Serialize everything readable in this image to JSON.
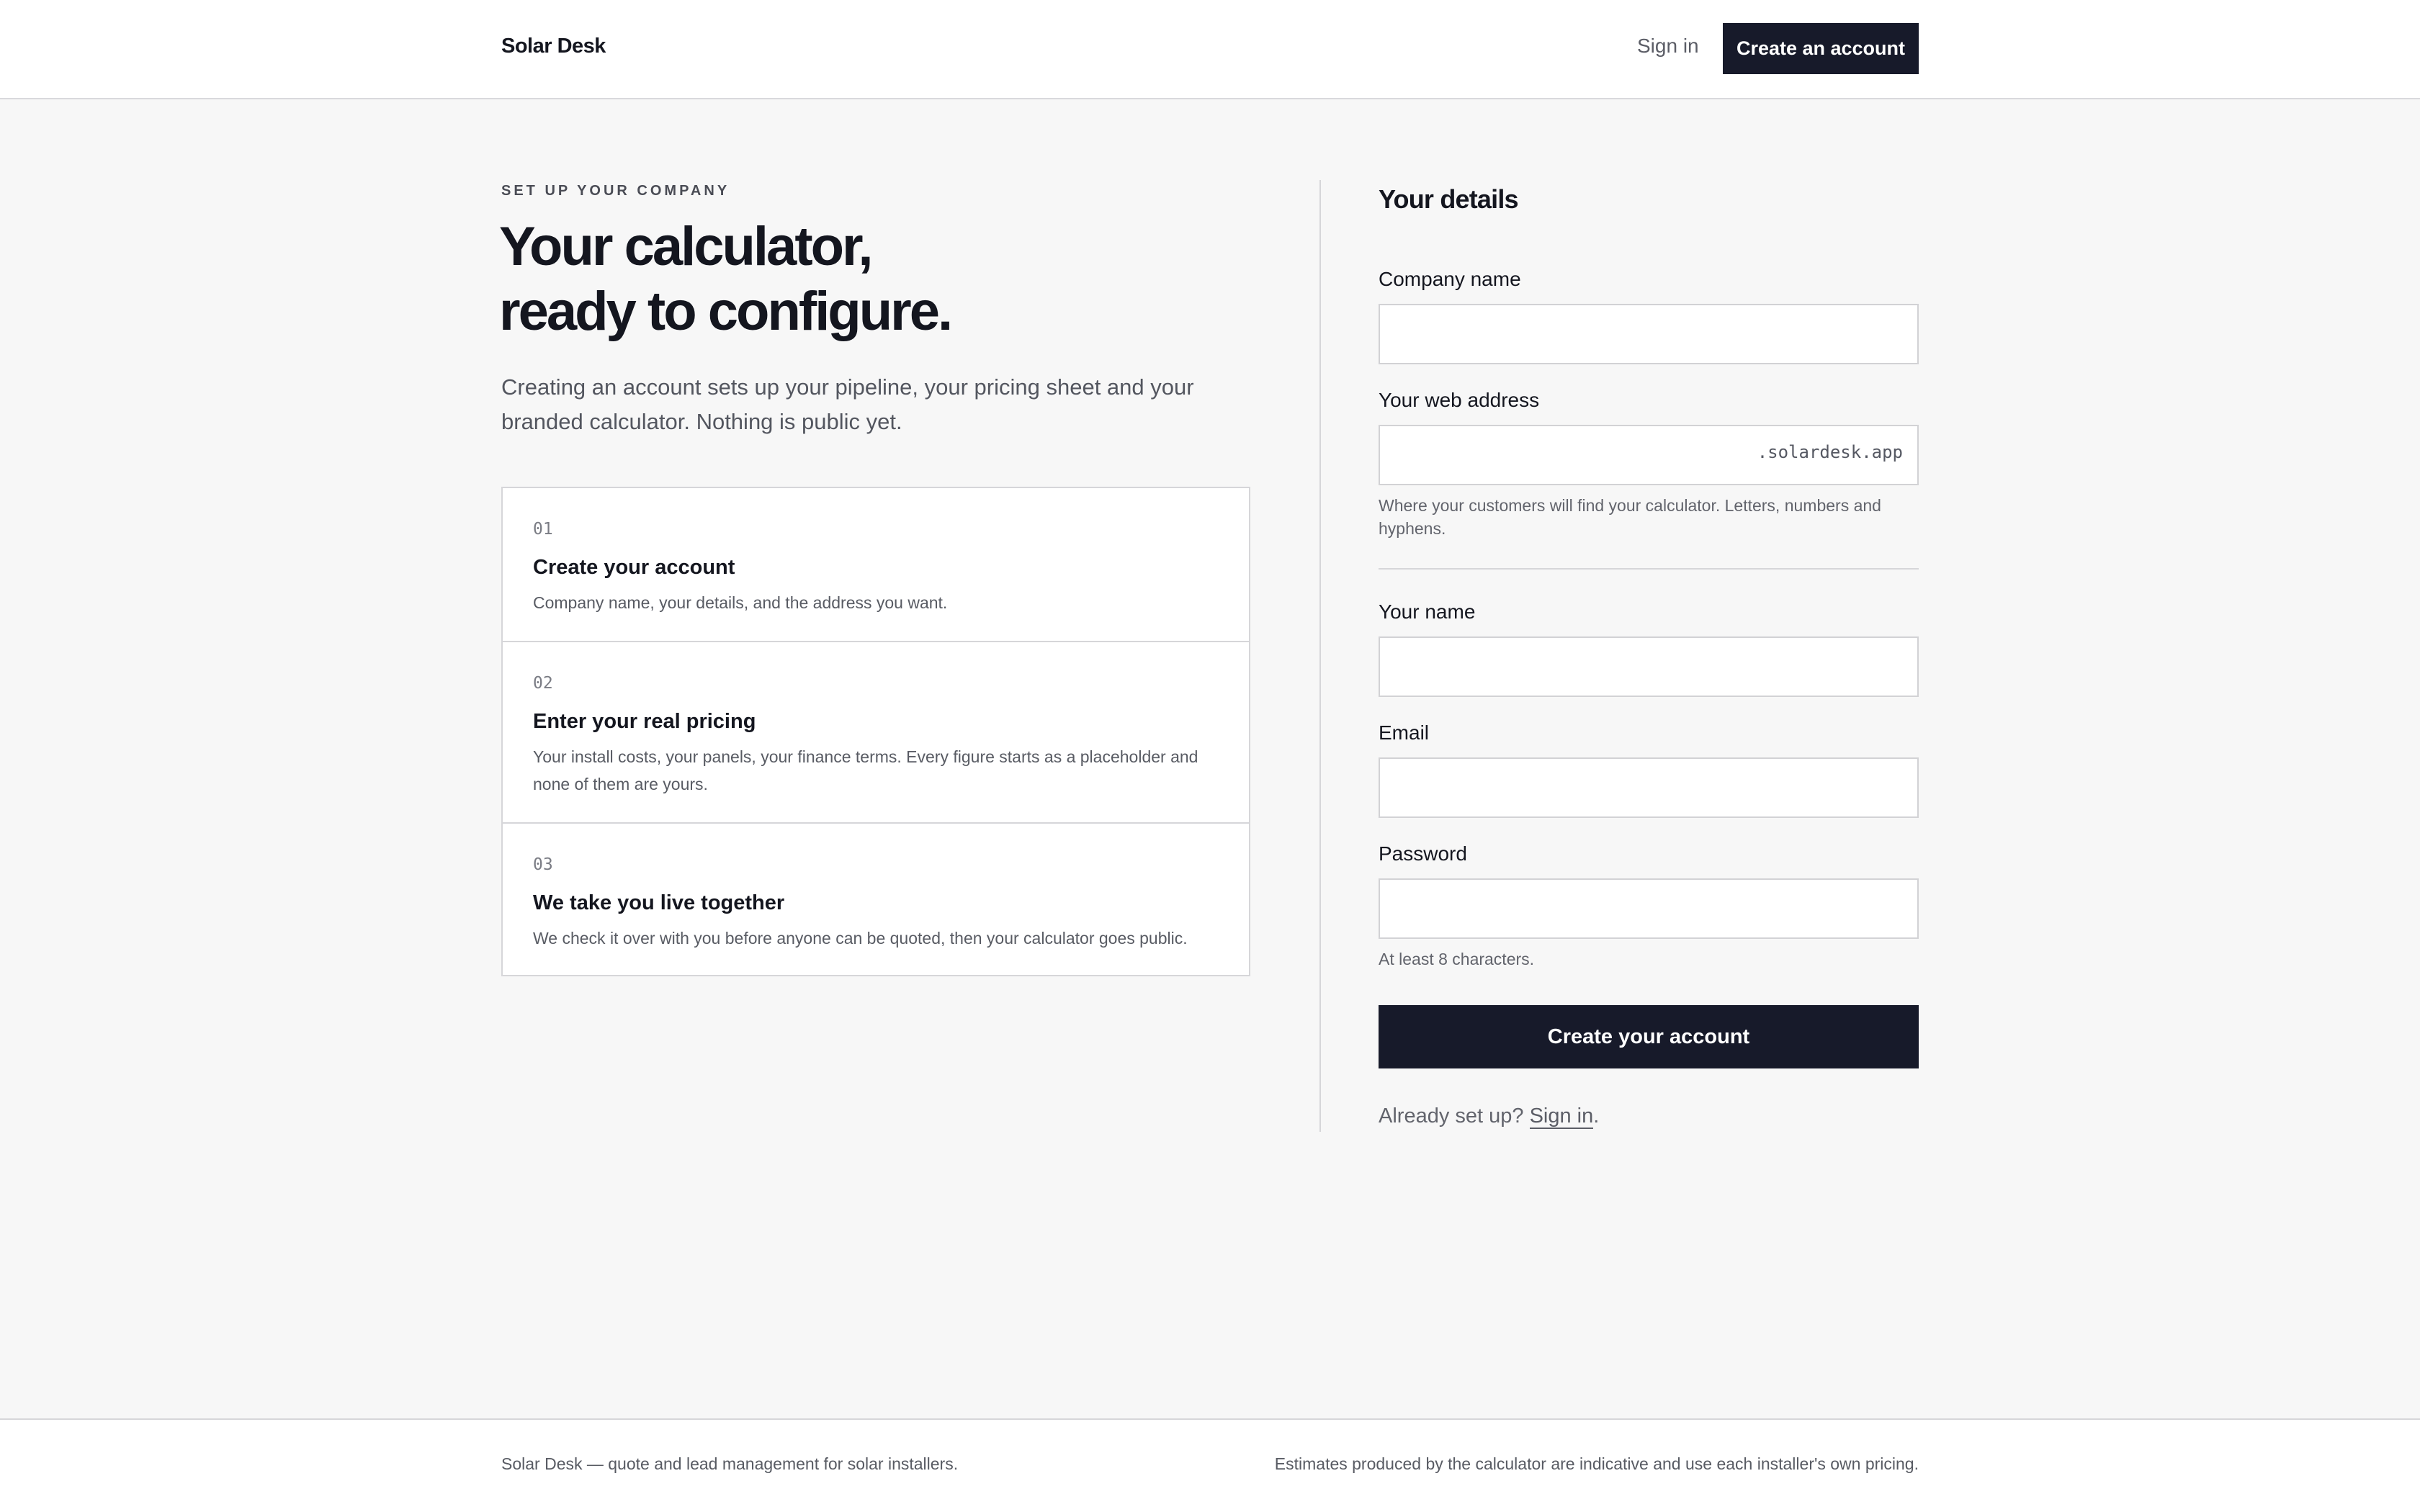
{
  "header": {
    "brand": "Solar Desk",
    "sign_in": "Sign in",
    "create_account": "Create an account"
  },
  "intro": {
    "eyebrow": "SET UP YOUR COMPANY",
    "title_line1": "Your calculator,",
    "title_line2": "ready to configure.",
    "description": "Creating an account sets up your pipeline, your pricing sheet and your branded calculator. Nothing is public yet."
  },
  "steps": [
    {
      "number": "01",
      "title": "Create your account",
      "description": "Company name, your details, and the address you want."
    },
    {
      "number": "02",
      "title": "Enter your real pricing",
      "description": "Your install costs, your panels, your finance terms. Every figure starts as a placeholder and none of them are yours."
    },
    {
      "number": "03",
      "title": "We take you live together",
      "description": "We check it over with you before anyone can be quoted, then your calculator goes public."
    }
  ],
  "form": {
    "title": "Your details",
    "company_name": {
      "label": "Company name",
      "value": ""
    },
    "web_address": {
      "label": "Your web address",
      "value": "",
      "suffix": ".solardesk.app",
      "hint": "Where your customers will find your calculator. Letters, numbers and hyphens."
    },
    "your_name": {
      "label": "Your name",
      "value": ""
    },
    "email": {
      "label": "Email",
      "value": ""
    },
    "password": {
      "label": "Password",
      "value": "",
      "hint": "At least 8 characters."
    },
    "submit": "Create your account",
    "already_prefix": "Already set up?",
    "already_link": "Sign in",
    "already_suffix": "."
  },
  "footer": {
    "left": "Solar Desk — quote and lead management for solar installers.",
    "right": "Estimates produced by the calculator are indicative and use each installer's own pricing."
  }
}
